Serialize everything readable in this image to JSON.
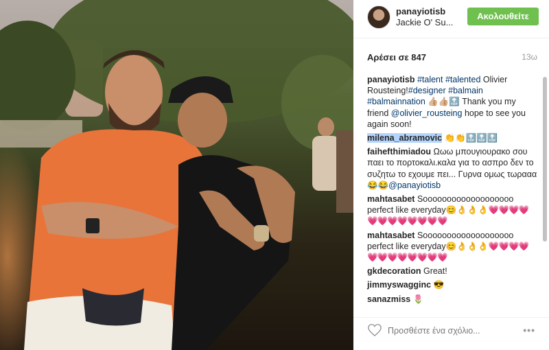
{
  "post": {
    "username": "panayiotisb",
    "location": "Jackie O' Su...",
    "follow_label": "Ακολουθείτε",
    "likes_text": "Αρέσει σε 847",
    "timestamp": "13ω"
  },
  "caption": {
    "user": "panayiotisb",
    "tags_line": "#talent #talented",
    "text1": " Olivier Rousteing!",
    "tags2": "#designer #balmain #balmainnation",
    "emoji": " 👍🏼👍🏼🔝 ",
    "text2": "Thank you my friend ",
    "mention": "@olivier_rousteing",
    "text3": " hope to see you again soon!"
  },
  "comments": [
    {
      "user": "milena_abramovic",
      "text": " 👏👏🔝🔝🔝"
    },
    {
      "user": "faihefthimiadou",
      "text": " Ωωω μπουγιουρακο σου παει το πορτοκαλι.καλα για το ασπρο δεν το συζητω το εχουμε πει... Γυρνα ομως τωρααα 😂😂",
      "mention": "@panayiotisb"
    },
    {
      "user": "mahtasabet",
      "text": " Sooooooooooooooooooo perfect like everyday😊👌👌👌",
      "hearts": "💗💗💗💗💗💗💗💗💗💗💗💗"
    },
    {
      "user": "mahtasabet",
      "text": " Sooooooooooooooooooo perfect like everyday😊👌👌👌",
      "hearts": "💗💗💗💗💗💗💗💗💗💗💗💗"
    },
    {
      "user": "gkdecoration",
      "text": " Great!"
    },
    {
      "user": "jimmyswagginc",
      "text": " 😎"
    },
    {
      "user": "sanazmiss",
      "text": " 🌷"
    }
  ],
  "footer": {
    "placeholder": "Προσθέστε ένα σχόλιο...",
    "more_label": "•••"
  },
  "colors": {
    "follow_green": "#70c050",
    "link_blue": "#003569",
    "heart_pink": "#d95bc9"
  }
}
